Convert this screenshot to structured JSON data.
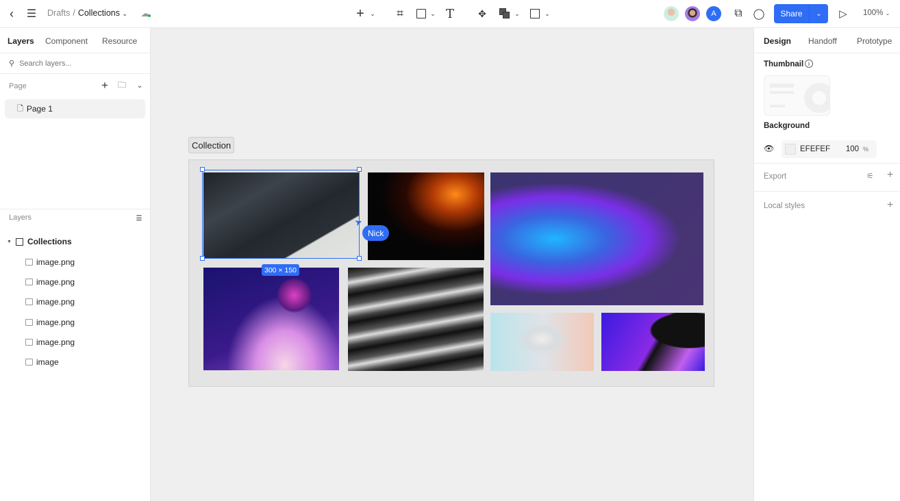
{
  "topbar": {
    "breadcrumb_parent": "Drafts",
    "breadcrumb_sep": "/",
    "file_name": "Collections",
    "share_label": "Share",
    "zoom": "100%",
    "avatar_letter": "A",
    "accent": "#2f6df6"
  },
  "left": {
    "tabs": [
      "Layers",
      "Component",
      "Resource"
    ],
    "search_placeholder": "Search layers...",
    "page_heading": "Page",
    "pages": [
      "Page 1"
    ],
    "layers_heading": "Layers",
    "root_layer": "Collections",
    "children": [
      "image.png",
      "image.png",
      "image.png",
      "image.png",
      "image.png",
      "image"
    ]
  },
  "canvas": {
    "frame_label": "Collection",
    "selection_size": "300 × 150",
    "cursor_user": "Nick",
    "background": "#efefef"
  },
  "right": {
    "tabs": [
      "Design",
      "Handoff",
      "Prototype"
    ],
    "thumbnail_label": "Thumbnail",
    "background_label": "Background",
    "bg_hex": "EFEFEF",
    "bg_opacity": "100",
    "bg_unit": "%",
    "export_label": "Export",
    "local_styles_label": "Local styles"
  }
}
